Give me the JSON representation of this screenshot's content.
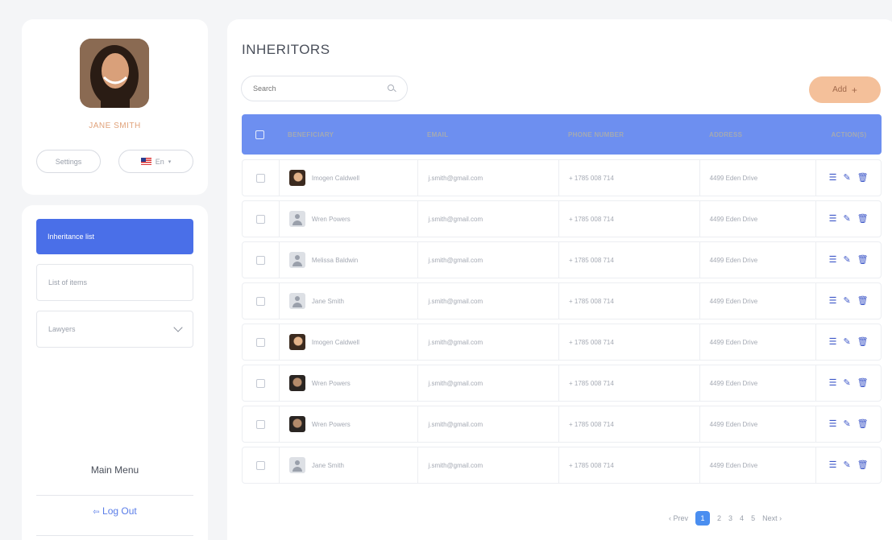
{
  "profile": {
    "name": "JANE SMITH",
    "settings_label": "Settings",
    "language_label": "En",
    "avatar_icon": "user-photo"
  },
  "nav": {
    "active_item": "Inheritance list",
    "items": [
      "List of items",
      "Lawyers"
    ],
    "main_menu": "Main Menu",
    "logout": "Log Out",
    "logout_icon": "logout-arrow-icon"
  },
  "main": {
    "title": "INHERITORS",
    "search_placeholder": "Search",
    "add_label": "Add",
    "add_icon": "plus-icon"
  },
  "table": {
    "headers": [
      "BENEFICIARY",
      "EMAIL",
      "PHONE NUMBER",
      "ADDRESS",
      "ACTION(S)"
    ],
    "rows": [
      {
        "name": "Imogen Caldwell",
        "email": "j.smith@gmail.com",
        "phone": "+ 1785 008 714",
        "address": "4499 Eden Drive",
        "avatar": "warm"
      },
      {
        "name": "Wren Powers",
        "email": "j.smith@gmail.com",
        "phone": "+ 1785 008 714",
        "address": "4499 Eden Drive",
        "avatar": "grey"
      },
      {
        "name": "Melissa Baldwin",
        "email": "j.smith@gmail.com",
        "phone": "+ 1785 008 714",
        "address": "4499 Eden Drive",
        "avatar": "grey"
      },
      {
        "name": "Jane Smith",
        "email": "j.smith@gmail.com",
        "phone": "+ 1785 008 714",
        "address": "4499 Eden Drive",
        "avatar": "grey"
      },
      {
        "name": "Imogen Caldwell",
        "email": "j.smith@gmail.com",
        "phone": "+ 1785 008 714",
        "address": "4499 Eden Drive",
        "avatar": "warm"
      },
      {
        "name": "Wren Powers",
        "email": "j.smith@gmail.com",
        "phone": "+ 1785 008 714",
        "address": "4499 Eden Drive",
        "avatar": "dark"
      },
      {
        "name": "Wren Powers",
        "email": "j.smith@gmail.com",
        "phone": "+ 1785 008 714",
        "address": "4499 Eden Drive",
        "avatar": "dark"
      },
      {
        "name": "Jane Smith",
        "email": "j.smith@gmail.com",
        "phone": "+ 1785 008 714",
        "address": "4499 Eden Drive",
        "avatar": "grey"
      }
    ],
    "action_icons": [
      "details-icon",
      "edit-icon",
      "delete-icon"
    ]
  },
  "pagination": {
    "prev": "Prev",
    "pages": [
      "1",
      "2",
      "3",
      "4",
      "5"
    ],
    "current": "1",
    "next": "Next"
  },
  "colors": {
    "accent": "#4a6fe8",
    "table_header": "#6d8ff0",
    "add_button": "#f4c09a",
    "name_text": "#e0a27a"
  }
}
